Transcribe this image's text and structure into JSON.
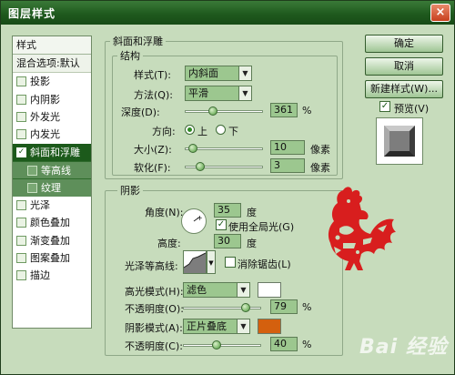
{
  "window": {
    "title": "图层样式",
    "close_glyph": "×"
  },
  "left_panel": {
    "header": "样式",
    "blend_options": "混合选项:默认",
    "items": [
      {
        "label": "投影",
        "checked": false
      },
      {
        "label": "内阴影",
        "checked": false
      },
      {
        "label": "外发光",
        "checked": false
      },
      {
        "label": "内发光",
        "checked": false
      },
      {
        "label": "斜面和浮雕",
        "checked": true
      },
      {
        "label": "等高线",
        "checked": false,
        "sub": true
      },
      {
        "label": "纹理",
        "checked": false,
        "sub": true
      },
      {
        "label": "光泽",
        "checked": false
      },
      {
        "label": "颜色叠加",
        "checked": false
      },
      {
        "label": "渐变叠加",
        "checked": false
      },
      {
        "label": "图案叠加",
        "checked": false
      },
      {
        "label": "描边",
        "checked": false
      }
    ]
  },
  "bevel": {
    "group_title": "斜面和浮雕",
    "structure_title": "结构",
    "style_label": "样式(T):",
    "style_value": "内斜面",
    "technique_label": "方法(Q):",
    "technique_value": "平滑",
    "depth_label": "深度(D):",
    "depth_value": "361",
    "depth_unit": "%",
    "direction_label": "方向:",
    "direction_up": "上",
    "direction_down": "下",
    "size_label": "大小(Z):",
    "size_value": "10",
    "size_unit": "像素",
    "soften_label": "软化(F):",
    "soften_value": "3",
    "soften_unit": "像素"
  },
  "shading": {
    "group_title": "阴影",
    "angle_label": "角度(N):",
    "angle_value": "35",
    "angle_unit": "度",
    "global_light_label": "使用全局光(G)",
    "altitude_label": "高度:",
    "altitude_value": "30",
    "altitude_unit": "度",
    "gloss_label": "光泽等高线:",
    "antialias_label": "消除锯齿(L)",
    "highlight_mode_label": "高光模式(H):",
    "highlight_mode_value": "滤色",
    "highlight_color": "#ffffff",
    "highlight_opacity_label": "不透明度(O):",
    "highlight_opacity_value": "79",
    "highlight_opacity_unit": "%",
    "shadow_mode_label": "阴影模式(A):",
    "shadow_mode_value": "正片叠底",
    "shadow_color": "#d4600e",
    "shadow_opacity_label": "不透明度(C):",
    "shadow_opacity_value": "40",
    "shadow_opacity_unit": "%"
  },
  "buttons": {
    "ok": "确定",
    "cancel": "取消",
    "new_style": "新建样式(W)...",
    "preview_label": "预览(V)"
  },
  "watermark": "Bai 经验"
}
